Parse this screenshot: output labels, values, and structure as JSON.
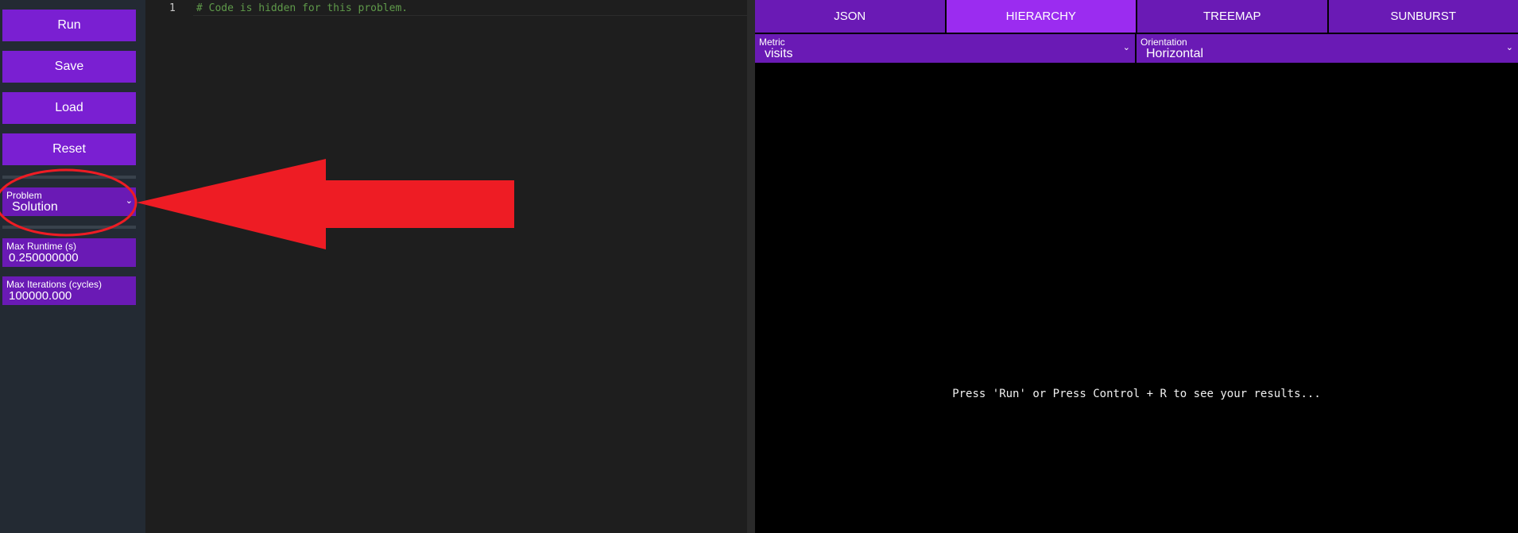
{
  "sidebar": {
    "buttons": {
      "run": "Run",
      "save": "Save",
      "load": "Load",
      "reset": "Reset"
    },
    "problem_select": {
      "label": "Problem",
      "value": "Solution"
    },
    "max_runtime": {
      "label": "Max Runtime (s)",
      "value": "0.250000000"
    },
    "max_iterations": {
      "label": "Max Iterations (cycles)",
      "value": "100000.000"
    }
  },
  "editor": {
    "line_number": "1",
    "code": "# Code is hidden for this problem."
  },
  "results": {
    "tabs": [
      "JSON",
      "HIERARCHY",
      "TREEMAP",
      "SUNBURST"
    ],
    "active_tab": "HIERARCHY",
    "metric": {
      "label": "Metric",
      "value": "visits"
    },
    "orientation": {
      "label": "Orientation",
      "value": "Horizontal"
    },
    "message": "Press 'Run' or Press Control + R to see your results..."
  },
  "colors": {
    "accent": "#7a1fd2",
    "accent_dark": "#6a1ab5",
    "active_tab": "#9b2cf0",
    "annotation_red": "#ee1c24"
  },
  "icons": {
    "dropdown": "chevron-down-icon",
    "annotation_arrow": "red-arrow",
    "annotation_circle": "red-ellipse"
  }
}
